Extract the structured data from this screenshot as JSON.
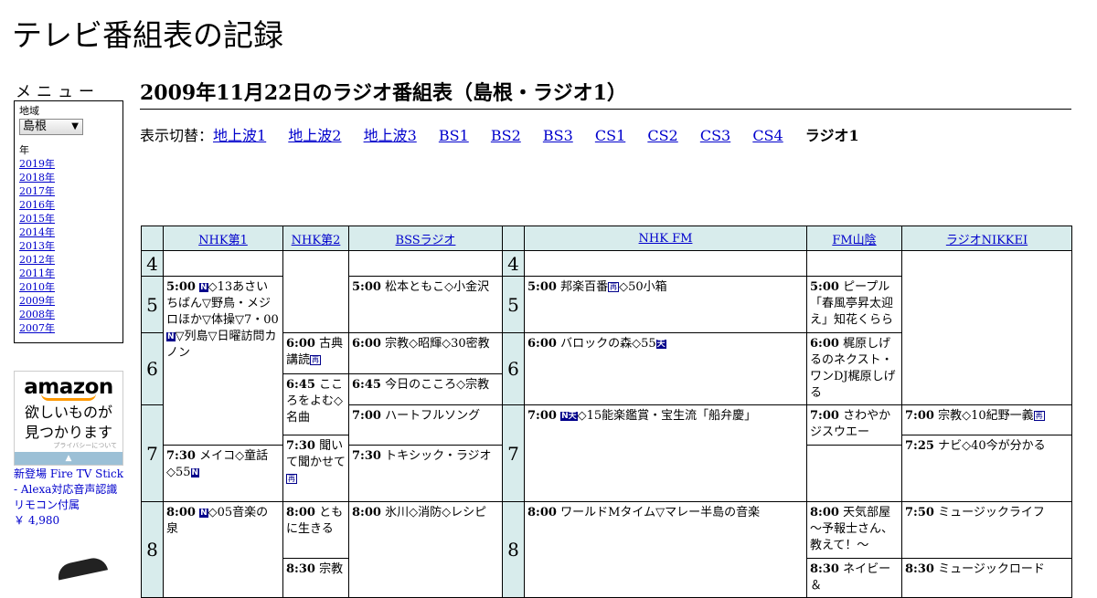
{
  "site": {
    "title": "テレビ番組表の記録"
  },
  "menu": {
    "title": "メニュー",
    "region_label": "地域",
    "region_value": "島根",
    "year_label": "年",
    "years": [
      "2019年",
      "2018年",
      "2017年",
      "2016年",
      "2015年",
      "2014年",
      "2013年",
      "2012年",
      "2011年",
      "2010年",
      "2009年",
      "2008年",
      "2007年"
    ]
  },
  "ad": {
    "logo": "amazon",
    "copy_line1": "欲しいものが",
    "copy_line2": "見つかります",
    "privacy": "プライバシーについて",
    "bar_symbol": "▲",
    "product_title": "新登場 Fire TV Stick - Alexa対応音声認識リモコン付属",
    "product_price": "￥ 4,980"
  },
  "heading": "2009年11月22日のラジオ番組表（島根・ラジオ1）",
  "switcher": {
    "label": "表示切替：",
    "links": [
      "地上波1",
      "地上波2",
      "地上波3",
      "BS1",
      "BS2",
      "BS3",
      "CS1",
      "CS2",
      "CS3",
      "CS4"
    ],
    "current": "ラジオ1"
  },
  "grid": {
    "channels": [
      "NHK第1",
      "NHK第2",
      "BSSラジオ",
      "NHK FM",
      "FM山陰",
      "ラジオNIKKEI"
    ],
    "hours": [
      "4",
      "5",
      "6",
      "7",
      "8"
    ],
    "programs": {
      "nhk1_500": {
        "time": "5:00",
        "pre": "",
        "text": "◇13あさいちばん▽野鳥・メジロほか▽体操▽7・00",
        "text2": "▽列島▽日曜訪問カノン"
      },
      "nhk1_800": {
        "time": "8:00",
        "text": "◇05音楽の泉"
      },
      "nhk2_600": {
        "time": "6:00",
        "text": "古典講読"
      },
      "nhk2_645": {
        "time": "6:45",
        "text": "こころをよむ◇名曲"
      },
      "nhk2_730": {
        "time": "7:30",
        "text": "聞いて聞かせて"
      },
      "nhk2_800": {
        "time": "8:00",
        "text": "ともに生きる"
      },
      "nhk2_830": {
        "time": "8:30",
        "text": "宗教"
      },
      "bss_500": {
        "time": "5:00",
        "text": "松本ともこ◇小金沢"
      },
      "bss_600": {
        "time": "6:00",
        "text": "宗教◇昭輝◇30密教"
      },
      "bss_645": {
        "time": "6:45",
        "text": "今日のこころ◇宗教"
      },
      "bss_700": {
        "time": "7:00",
        "text": "ハートフルソング"
      },
      "bss_730": {
        "time": "7:30",
        "text": "メイコ◇童話◇55"
      },
      "bss_800": {
        "time": "8:00",
        "text": "氷川◇消防◇レシピ"
      },
      "fm_500": {
        "time": "5:00",
        "text": "邦楽百番",
        "text2": "◇50小箱"
      },
      "fm_600": {
        "time": "6:00",
        "text": "バロックの森◇55"
      },
      "fm_700": {
        "time": "7:00",
        "text": "◇15能楽鑑賞・宝生流「船弁慶」"
      },
      "fm_800": {
        "time": "8:00",
        "text": "ワールドMタイム▽マレー半島の音楽"
      },
      "san_500": {
        "time": "5:00",
        "text": "ピープル「春風亭昇太迎え」知花くらら"
      },
      "san_600": {
        "time": "6:00",
        "text": "梶原しげるのネクスト・ワンDJ梶原しげる"
      },
      "san_700": {
        "time": "7:00",
        "text": "さわやかジスウエー"
      },
      "san_730": {
        "time": "7:30",
        "text": "トキシック・ラジオ"
      },
      "san_800": {
        "time": "8:00",
        "text": "天気部屋～予報士さん、教えて！～"
      },
      "san_830": {
        "time": "8:30",
        "text": "ネイビー＆"
      },
      "nk_700": {
        "time": "7:00",
        "text": "宗教◇10紀野一義"
      },
      "nk_725": {
        "time": "7:25",
        "text": "ナビ◇40今が分かる"
      },
      "nk_750": {
        "time": "7:50",
        "text": "ミュージックライフ"
      },
      "nk_830": {
        "time": "8:30",
        "text": "ミュージックロード"
      }
    },
    "badges": {
      "n": "N",
      "sai": "再",
      "ten": "天",
      "n_ten": "N天"
    }
  }
}
